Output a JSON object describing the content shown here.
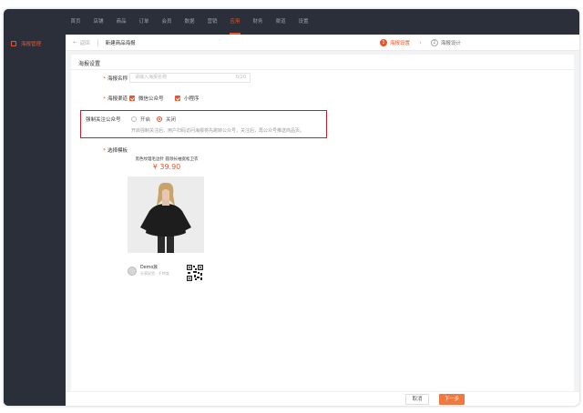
{
  "nav": {
    "items": [
      "首页",
      "店铺",
      "商品",
      "订单",
      "会员",
      "数据",
      "营销",
      "应用",
      "财务",
      "渠道",
      "设置"
    ],
    "active_index": 7,
    "accent_color": "#e8562a"
  },
  "sidebar": {
    "active_item": "海报管理",
    "active_icon": "document-icon"
  },
  "header": {
    "back_label": "返回",
    "title": "新建商品海报",
    "steps": [
      {
        "num": "1",
        "label": "海报设置"
      },
      {
        "num": "2",
        "label": "海报设计"
      }
    ]
  },
  "form": {
    "section_title": "海报设置",
    "name_label": "海报名称",
    "name_placeholder": "请输入海报名称",
    "name_count": "0/20",
    "channel_label": "海报渠道",
    "channels": [
      "微信公众号",
      "小程序"
    ],
    "follow_label": "强制关注公众号",
    "follow_options": [
      "开启",
      "关闭"
    ],
    "follow_selected": "关闭",
    "follow_hint": "开启强制关注后，用户扫码访问海报将先跳转公众号，关注后，再公众号推送商品页。",
    "template_label": "选择模板"
  },
  "template": {
    "product_name": "黑色纹理毛边针 圆领长袖宽松卫衣",
    "price": "¥ 39.90",
    "shop_name": "Demo族",
    "shop_sub": "分享好货 · 千特卖"
  },
  "footer": {
    "cancel_label": "取消",
    "next_label": "下一步"
  }
}
